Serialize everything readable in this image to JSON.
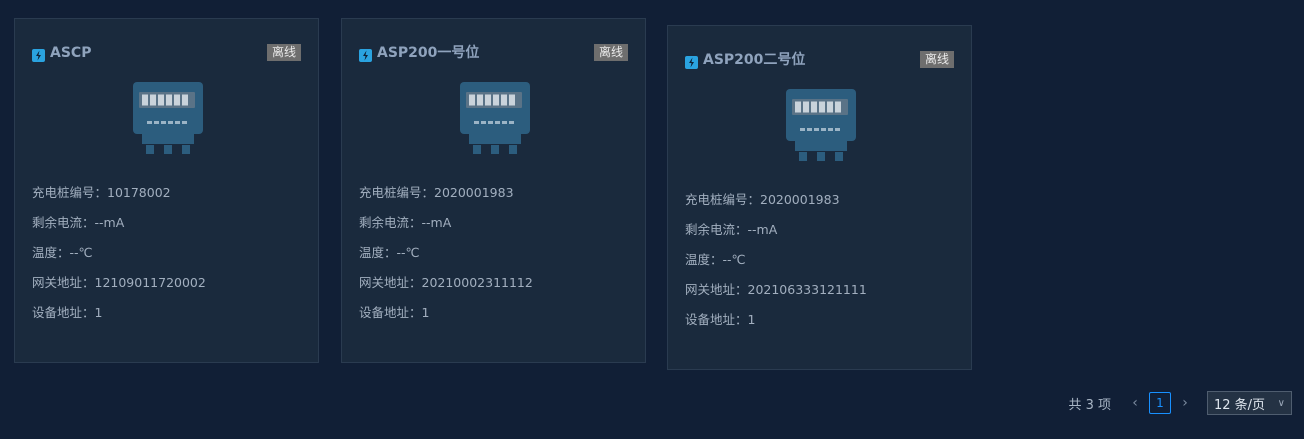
{
  "cards": [
    {
      "title": "ASCP",
      "status": "离线",
      "rows": [
        "充电桩编号：10178002",
        "剩余电流：--mA",
        "温度：--℃",
        "网关地址：12109011720002",
        "设备地址：1"
      ]
    },
    {
      "title": "ASP200一号位",
      "status": "离线",
      "rows": [
        "充电桩编号：2020001983",
        "剩余电流：--mA",
        "温度：--℃",
        "网关地址：20210002311112",
        "设备地址：1"
      ]
    },
    {
      "title": "ASP200二号位",
      "status": "离线",
      "rows": [
        "充电桩编号：2020001983",
        "剩余电流：--mA",
        "温度：--℃",
        "网关地址：202106333121111",
        "设备地址：1"
      ]
    }
  ],
  "pagination": {
    "total_text": "共 3 项",
    "prev_icon": "‹",
    "current_page": "1",
    "next_icon": "›",
    "page_size": "12 条/页",
    "chevron": "∨"
  },
  "colors": {
    "background": "#111f36",
    "card": "#1a2a3d",
    "status_offline": "#6e6e6e",
    "accent": "#1890ff"
  },
  "icons": {
    "card_title": "plug-icon",
    "device": "meter-icon"
  }
}
